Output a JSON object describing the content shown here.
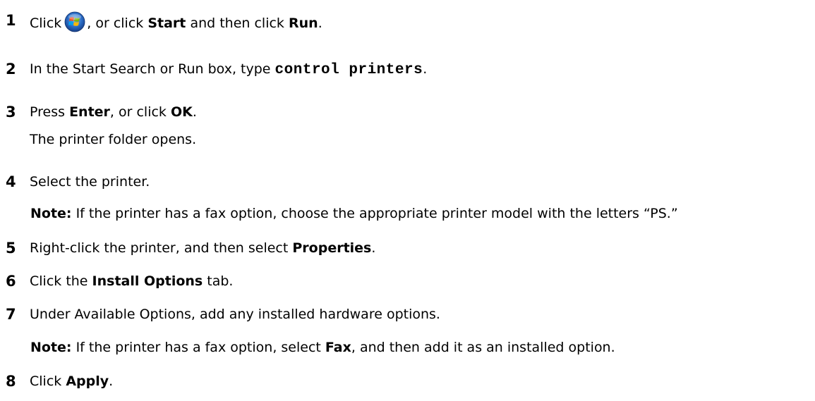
{
  "steps": [
    {
      "number": "1",
      "click": "Click",
      "or_click": ", or click",
      "start": "Start",
      "and_then_click": "and then click",
      "run": "Run",
      "period": "."
    },
    {
      "number": "2",
      "prefix": "In the Start Search or Run box, type",
      "command": "control printers",
      "period": "."
    },
    {
      "number": "3",
      "press": "Press",
      "enter": "Enter",
      "or_click": ", or click",
      "ok": "OK",
      "period": ".",
      "result": "The printer folder opens."
    },
    {
      "number": "4",
      "text": "Select the printer.",
      "note_label": "Note:",
      "note_text": "If the printer has a fax option, choose the appropriate printer model with the letters “PS.”"
    },
    {
      "number": "5",
      "prefix": "Right-click the printer, and then select",
      "properties": "Properties",
      "period": "."
    },
    {
      "number": "6",
      "click_the": "Click the",
      "install_options": "Install Options",
      "tab": "tab."
    },
    {
      "number": "7",
      "text": "Under Available Options, add any installed hardware options.",
      "note_label": "Note:",
      "note_prefix": "If the printer has a fax option, select",
      "fax": "Fax",
      "note_suffix": ", and then add it as an installed option."
    },
    {
      "number": "8",
      "click": "Click",
      "apply": "Apply",
      "period": "."
    }
  ],
  "icons": {
    "start_orb": "windows-start-orb-icon"
  }
}
